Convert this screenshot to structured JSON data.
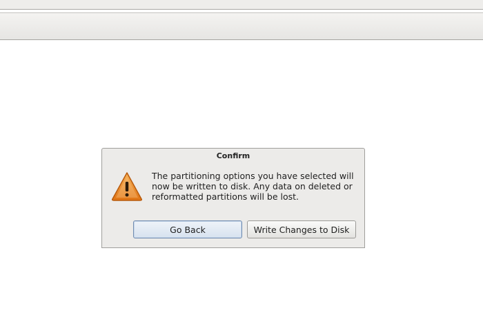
{
  "dialog": {
    "title": "Confirm",
    "icon": "warning-icon",
    "message": "The partitioning options you have selected will\nnow be written to disk.  Any data on deleted or\nreformatted partitions will be lost.",
    "buttons": {
      "back_label": "Go Back",
      "write_label": "Write Changes to Disk"
    }
  },
  "colors": {
    "dialog_bg": "#ecebe9",
    "warning_orange": "#e8851e",
    "focus_border": "#6f8bb0"
  }
}
